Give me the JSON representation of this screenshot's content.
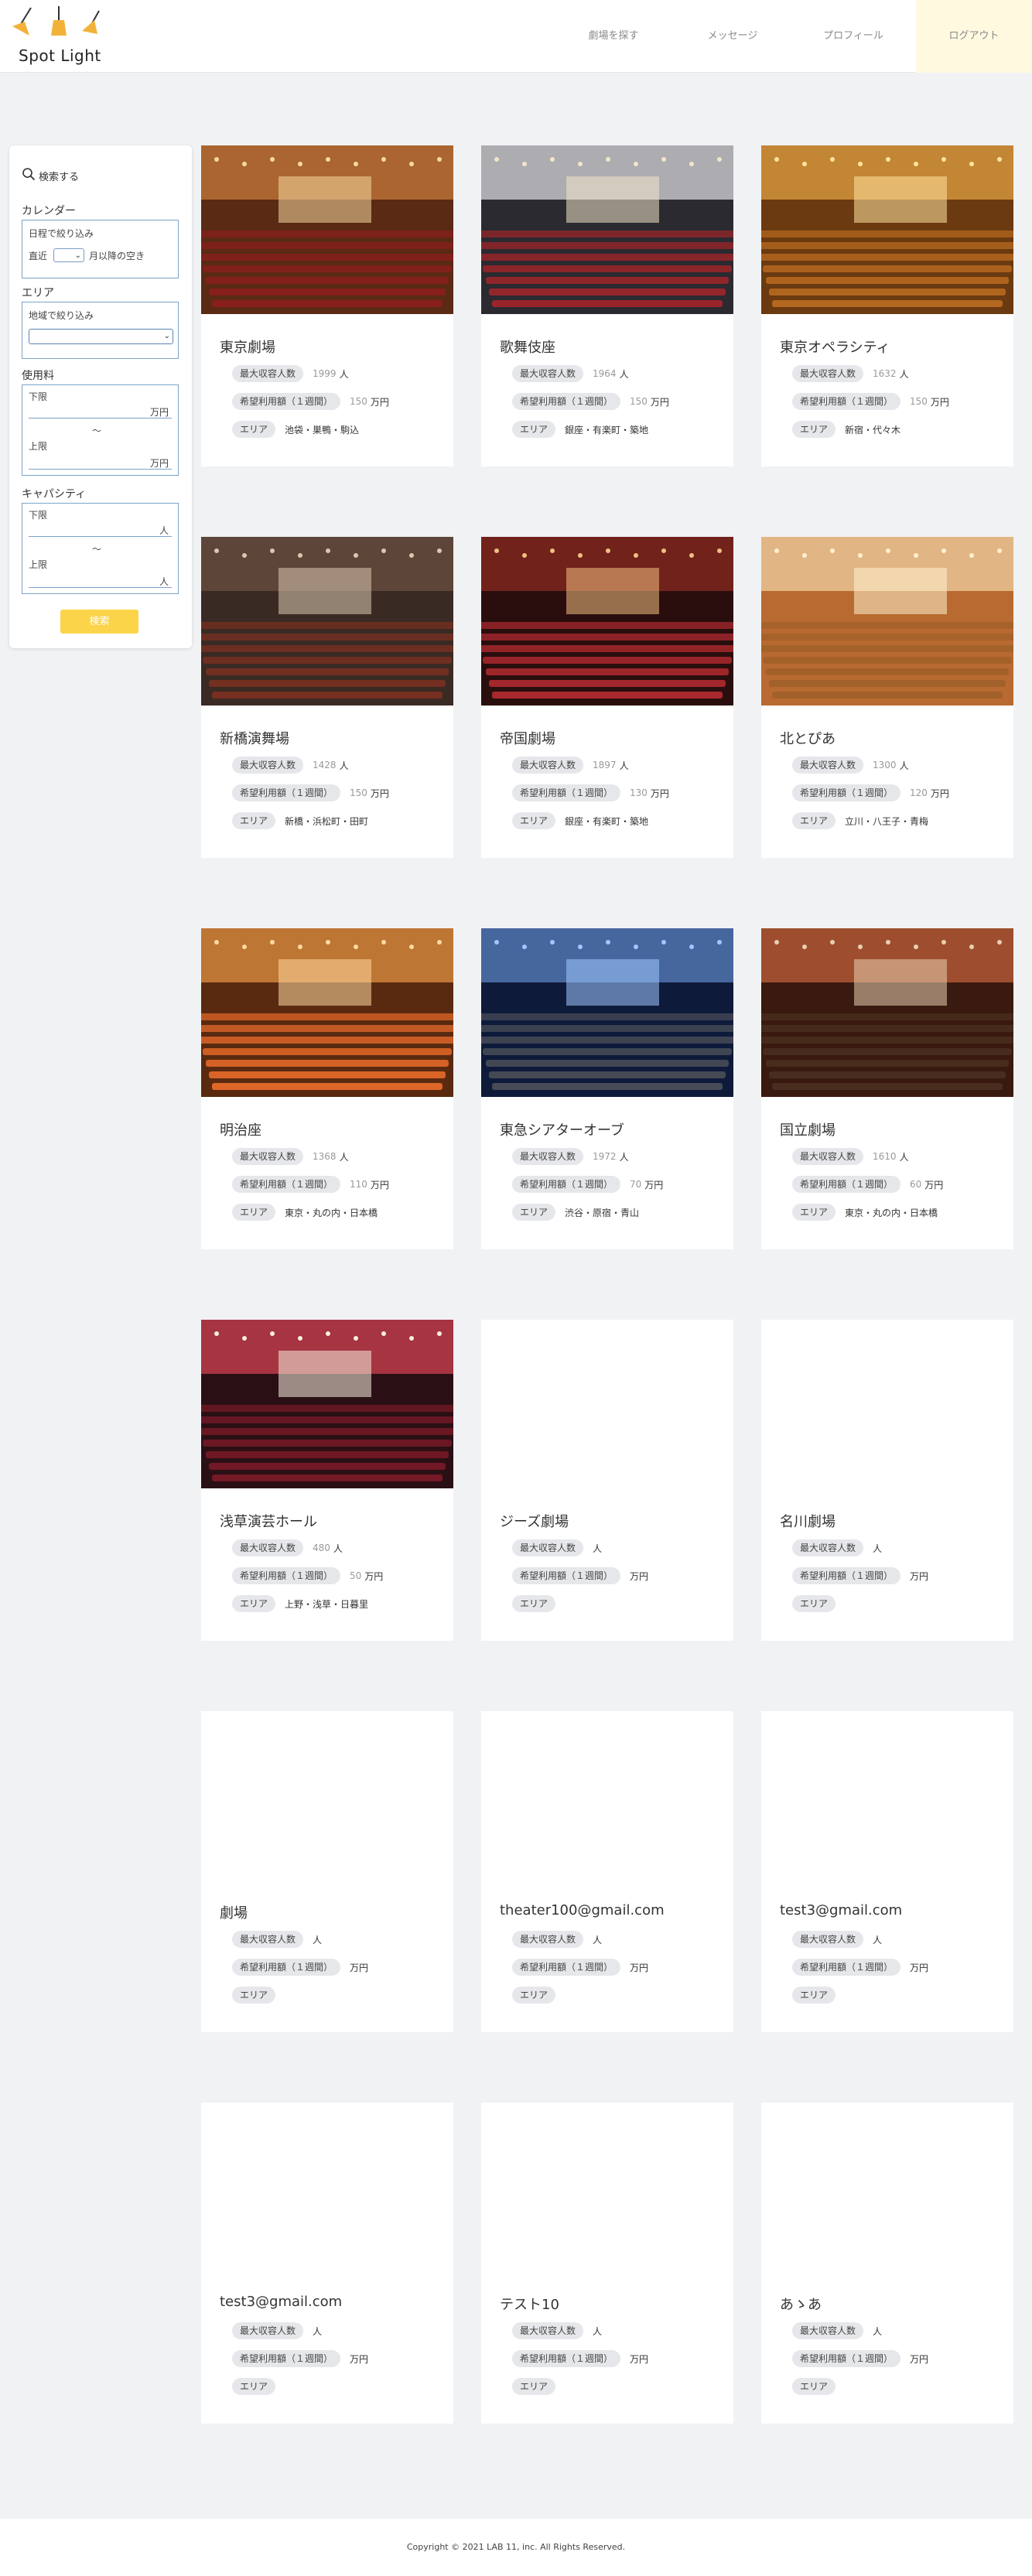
{
  "header": {
    "logo_text": "Spot Light",
    "nav": [
      {
        "label": "劇場を探す"
      },
      {
        "label": "メッセージ"
      },
      {
        "label": "プロフィール"
      },
      {
        "label": "ログアウト"
      }
    ]
  },
  "sidebar": {
    "search_label": "検索する",
    "calendar": {
      "heading": "カレンダー",
      "filter_label": "日程で絞り込み",
      "recent": "直近",
      "suffix": "月以降の空き"
    },
    "area": {
      "heading": "エリア",
      "filter_label": "地域で絞り込み"
    },
    "fee": {
      "heading": "使用料",
      "lower": "下限",
      "upper": "上限",
      "unit": "万円",
      "tilde": "〜"
    },
    "capacity": {
      "heading": "キャパシティ",
      "lower": "下限",
      "upper": "上限",
      "unit": "人",
      "tilde": "〜"
    },
    "search_button": "検索"
  },
  "labels": {
    "capacity": "最大収容人数",
    "fee": "希望利用額（１週間）",
    "area": "エリア",
    "people_unit": "人",
    "fee_unit": "万円"
  },
  "theaters": [
    {
      "name": "東京劇場",
      "capacity": "1999",
      "fee": "150",
      "area": "池袋・巣鴨・駒込",
      "photo": true
    },
    {
      "name": "歌舞伎座",
      "capacity": "1964",
      "fee": "150",
      "area": "銀座・有楽町・築地",
      "photo": true
    },
    {
      "name": "東京オペラシティ",
      "capacity": "1632",
      "fee": "150",
      "area": "新宿・代々木",
      "photo": true
    },
    {
      "name": "新橋演舞場",
      "capacity": "1428",
      "fee": "150",
      "area": "新橋・浜松町・田町",
      "photo": true
    },
    {
      "name": "帝国劇場",
      "capacity": "1897",
      "fee": "130",
      "area": "銀座・有楽町・築地",
      "photo": true
    },
    {
      "name": "北とぴあ",
      "capacity": "1300",
      "fee": "120",
      "area": "立川・八王子・青梅",
      "photo": true
    },
    {
      "name": "明治座",
      "capacity": "1368",
      "fee": "110",
      "area": "東京・丸の内・日本橋",
      "photo": true
    },
    {
      "name": "東急シアターオーブ",
      "capacity": "1972",
      "fee": "70",
      "area": "渋谷・原宿・青山",
      "photo": true
    },
    {
      "name": "国立劇場",
      "capacity": "1610",
      "fee": "60",
      "area": "東京・丸の内・日本橋",
      "photo": true
    },
    {
      "name": "浅草演芸ホール",
      "capacity": "480",
      "fee": "50",
      "area": "上野・浅草・日暮里",
      "photo": true
    },
    {
      "name": "ジーズ劇場",
      "capacity": "",
      "fee": "",
      "area": "",
      "photo": false
    },
    {
      "name": "名川劇場",
      "capacity": "",
      "fee": "",
      "area": "",
      "photo": false
    },
    {
      "name": "劇場",
      "capacity": "",
      "fee": "",
      "area": "",
      "photo": false
    },
    {
      "name": "theater100@gmail.com",
      "capacity": "",
      "fee": "",
      "area": "",
      "photo": false
    },
    {
      "name": "test3@gmail.com",
      "capacity": "",
      "fee": "",
      "area": "",
      "photo": false
    },
    {
      "name": "test3@gmail.com",
      "capacity": "",
      "fee": "",
      "area": "",
      "photo": false
    },
    {
      "name": "テスト10",
      "capacity": "",
      "fee": "",
      "area": "",
      "photo": false
    },
    {
      "name": "あゝあ",
      "capacity": "",
      "fee": "",
      "area": "",
      "photo": false
    }
  ],
  "footer": {
    "copyright": "Copyright © 2021 LAB 11, inc. All Rights Reserved."
  }
}
